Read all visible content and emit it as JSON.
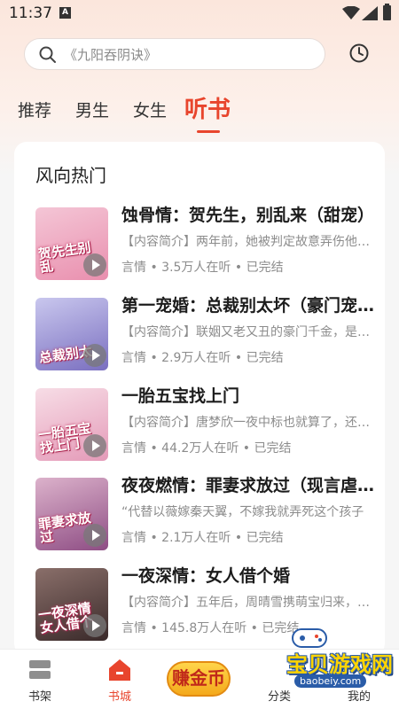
{
  "status_bar": {
    "time": "11:37",
    "indicator": "A"
  },
  "search": {
    "placeholder": "《九阳吞阴诀》"
  },
  "tabs": [
    {
      "label": "推荐"
    },
    {
      "label": "男生"
    },
    {
      "label": "女生"
    },
    {
      "label": "听书",
      "active": true
    }
  ],
  "section": {
    "title": "风向热门"
  },
  "books": [
    {
      "title": "蚀骨情：贺先生，别乱来（甜宠）",
      "intro": "【内容简介】两年前，她被判定故意弄伤他人入狱",
      "meta": "言情 • 3.5万人在听 • 已完结",
      "cover_text": "贺先生别乱",
      "cover_colors": [
        "#f4c6d6",
        "#e98fae"
      ]
    },
    {
      "title": "第一宠婚：总裁别太坏（豪门宠婚）",
      "intro": "【内容简介】联姻又老又丑的豪门千金，是她的命",
      "meta": "言情 • 2.9万人在听 • 已完结",
      "cover_text": "总裁别太",
      "cover_colors": [
        "#b9b8e8",
        "#7a6fc0"
      ]
    },
    {
      "title": "一胎五宝找上门",
      "intro": "【内容简介】唐梦欣一夜中标也就算了，还怀了五胞胎",
      "meta": "言情 • 44.2万人在听 • 已完结",
      "cover_text": "一胎五宝找上门",
      "cover_colors": [
        "#f7d6e0",
        "#e49ab8"
      ]
    },
    {
      "title": "夜夜燃情：罪妻求放过（现言虐恋）",
      "intro": "“代替以薇嫁秦天翼，不嫁我就弄死这个孩子",
      "meta": "言情 • 2.1万人在听 • 已完结",
      "cover_text": "罪妻求放过",
      "cover_colors": [
        "#d8a6c2",
        "#8e4d84"
      ]
    },
    {
      "title": "一夜深情：女人借个婚",
      "intro": "【内容简介】五年后，周晴雪携萌宝归来，却遇前夫",
      "meta": "言情 • 145.8万人在听 • 已完结",
      "cover_text": "一夜深情女人借个",
      "cover_colors": [
        "#8a6f6a",
        "#3a2a2a"
      ]
    }
  ],
  "bottom_nav": [
    {
      "label": "书架",
      "icon": "bookshelf-icon"
    },
    {
      "label": "书城",
      "icon": "home-icon",
      "active": true
    },
    {
      "label": "赚金币",
      "icon": "coin-button"
    },
    {
      "label": "分类",
      "icon": "category-icon"
    },
    {
      "label": "我的",
      "icon": "profile-icon"
    }
  ],
  "watermark": {
    "title": "宝贝游戏网",
    "url": "baobeiy.com"
  },
  "colors": {
    "accent": "#e8452d",
    "text_secondary": "#8c8c8c"
  }
}
